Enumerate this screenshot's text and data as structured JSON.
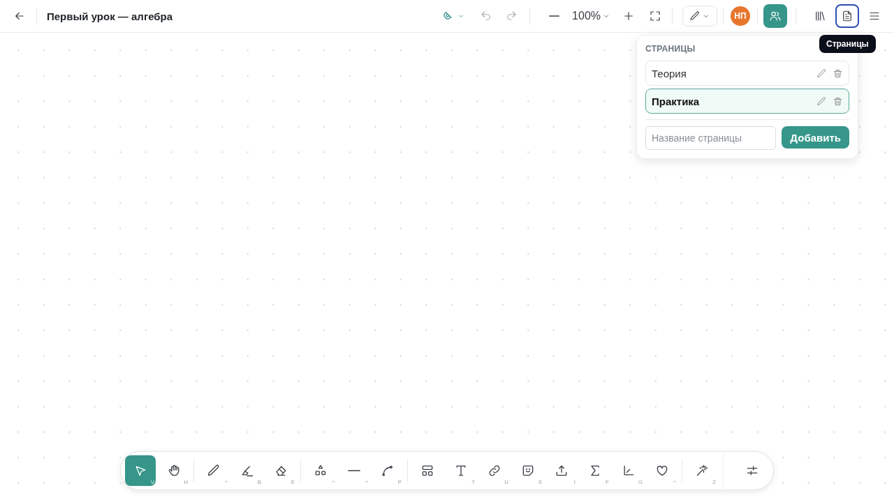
{
  "top_bar": {
    "title": "Первый урок — алгебра",
    "undo": {
      "disabled": true
    },
    "redo": {
      "disabled": true
    },
    "zoom": "100%",
    "avatar": "НП",
    "collaborators": {
      "selected": true
    },
    "pages": {
      "selected": true
    },
    "tooltip": "Страницы"
  },
  "pages_panel": {
    "heading": "СТРАНИЦЫ",
    "pages": [
      {
        "name": "Теория",
        "selected": false
      },
      {
        "name": "Практика",
        "selected": true
      }
    ],
    "new_page": {
      "placeholder": "Название страницы"
    },
    "add_button": "Добавить"
  },
  "toolbar": {
    "groups": [
      [
        {
          "kind": "select",
          "shortcut": "V",
          "selected": true
        },
        {
          "kind": "hand",
          "shortcut": "H",
          "selected": false
        }
      ],
      [
        {
          "kind": "pen",
          "shortcut": "^",
          "selected": false
        },
        {
          "kind": "highlighter",
          "shortcut": "B",
          "selected": false
        },
        {
          "kind": "eraser",
          "shortcut": "E",
          "selected": false
        }
      ],
      [
        {
          "kind": "shapes",
          "shortcut": "^",
          "selected": false
        },
        {
          "kind": "line",
          "shortcut": "^",
          "selected": false
        },
        {
          "kind": "curve",
          "shortcut": "P",
          "selected": false
        }
      ],
      [
        {
          "kind": "layout",
          "selected": false
        },
        {
          "kind": "text",
          "shortcut": "T",
          "selected": false
        },
        {
          "kind": "link",
          "shortcut": "U",
          "selected": false
        },
        {
          "kind": "sticker",
          "shortcut": "S",
          "selected": false
        },
        {
          "kind": "upload",
          "shortcut": "I",
          "selected": false
        },
        {
          "kind": "sigma",
          "shortcut": "F",
          "selected": false
        },
        {
          "kind": "graph",
          "shortcut": "G",
          "selected": false
        },
        {
          "kind": "heart",
          "shortcut": "^",
          "selected": false
        }
      ],
      [
        {
          "kind": "magic",
          "shortcut": "Z",
          "selected": false
        }
      ]
    ]
  }
}
